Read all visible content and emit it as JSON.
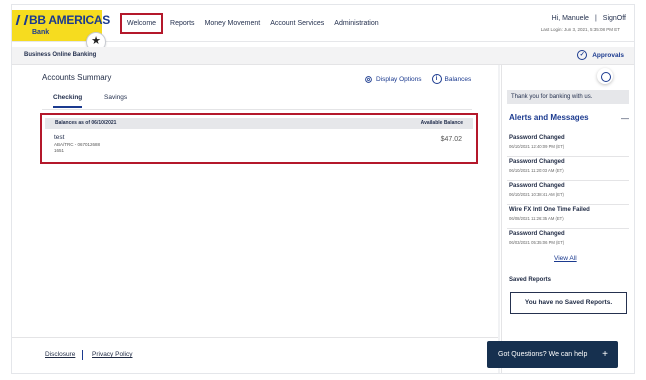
{
  "brand": {
    "name": "BB AMERICAS",
    "sub": "Bank"
  },
  "nav": {
    "items": [
      "Welcome",
      "Reports",
      "Money Movement",
      "Account Services",
      "Administration"
    ]
  },
  "user": {
    "greeting": "Hi, Manuele",
    "separator": "|",
    "signoff": "SignOff",
    "last_login": "Last Login: Jun 3, 2021, 5:35:08 PM ET"
  },
  "subheader": {
    "title": "Business Online Banking",
    "approvals": "Approvals"
  },
  "accounts": {
    "title": "Accounts Summary",
    "display_options": "Display Options",
    "balances": "Balances",
    "tabs": [
      "Checking",
      "Savings"
    ],
    "balance_header": "Balances as of 06/10/2021",
    "available_header": "Available Balance",
    "rows": [
      {
        "name": "test",
        "aba": "ABA/TRC - 067012688",
        "number": "1651",
        "amount": "$47.02"
      }
    ]
  },
  "footer": {
    "disclosure": "Disclosure",
    "privacy": "Privacy Policy"
  },
  "sidebar": {
    "thanks": "Thank you for banking with us.",
    "alerts_title": "Alerts and Messages",
    "collapse": "—",
    "alerts": [
      {
        "title": "Password Changed",
        "time": "06/10/2021 12:40:09 PM (ET)"
      },
      {
        "title": "Password Changed",
        "time": "06/10/2021 11:20:03 AM (ET)"
      },
      {
        "title": "Password Changed",
        "time": "06/10/2021 10:38:41 AM (ET)"
      },
      {
        "title": "Wire FX Intl One Time Failed",
        "time": "06/08/2021 11:26:35 AM (ET)"
      },
      {
        "title": "Password Changed",
        "time": "06/03/2021 05:35:06 PM (ET)"
      }
    ],
    "view_all": "View All",
    "saved_reports_title": "Saved Reports",
    "saved_reports_empty": "You have no Saved Reports."
  },
  "chat": {
    "label": "Got Questions? We can help",
    "plus": "+"
  },
  "colors": {
    "brand_blue": "#1b3a8f",
    "brand_yellow": "#f6dc1f",
    "highlight_red": "#b4182b",
    "chat_navy": "#16304f"
  }
}
